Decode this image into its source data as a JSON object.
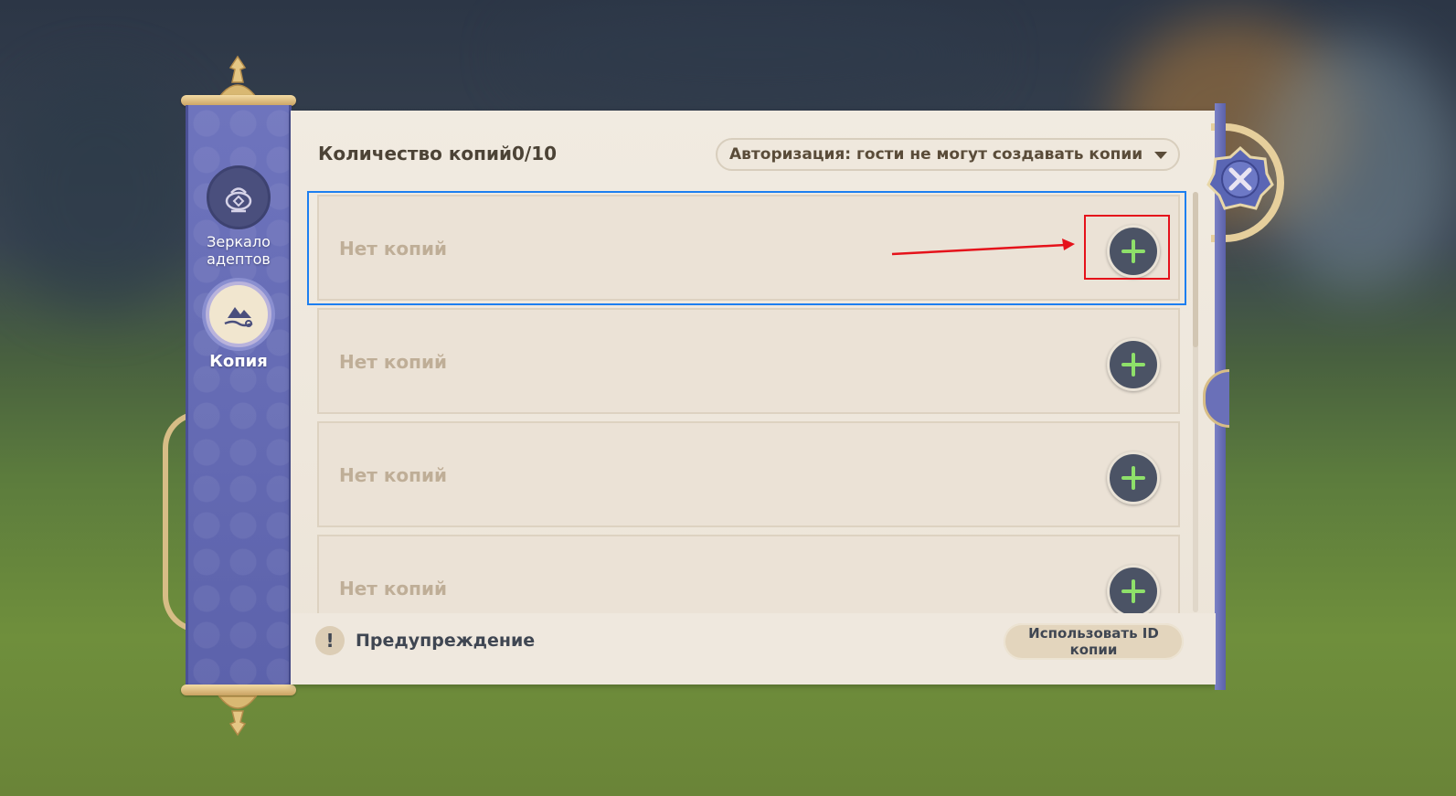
{
  "sidebar": {
    "items": [
      {
        "label": "Зеркало адептов",
        "icon": "teapot-icon",
        "active": false
      },
      {
        "label": "Копия",
        "icon": "landscape-icon",
        "active": true
      }
    ]
  },
  "header": {
    "title": "Количество копий0/10",
    "auth_select": "Авторизация: гости не могут создавать копии"
  },
  "slots": [
    {
      "text": "Нет копий"
    },
    {
      "text": "Нет копий"
    },
    {
      "text": "Нет копий"
    },
    {
      "text": "Нет копий"
    }
  ],
  "footer": {
    "warning_icon": "!",
    "warning_label": "Предупреждение",
    "use_id_button": "Использовать ID копии"
  },
  "icons": {
    "close": "close-icon",
    "add": "plus-icon"
  },
  "colors": {
    "accent_green": "#8ee06a",
    "highlight_blue": "#1d7ff0",
    "highlight_red": "#e5121b",
    "sidebar_purple": "#6e74bd"
  }
}
